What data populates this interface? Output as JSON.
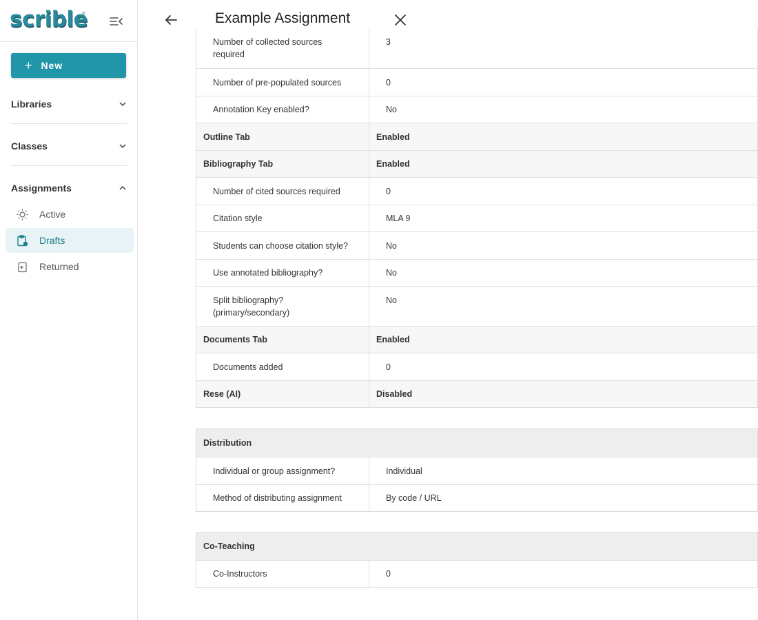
{
  "sidebar": {
    "logo": "scrible",
    "logo_mark": "®",
    "new_label": "New",
    "sections": {
      "libraries": "Libraries",
      "classes": "Classes",
      "assignments": "Assignments"
    },
    "assignment_items": {
      "active": "Active",
      "drafts": "Drafts",
      "returned": "Returned"
    },
    "accent_color": "#2096a8"
  },
  "header": {
    "title": "Example Assignment"
  },
  "settings": {
    "collected_sources_label": "Number of collected sources required",
    "collected_sources_value": "3",
    "prepopulated_label": "Number of pre-populated sources",
    "prepopulated_value": "0",
    "annotation_key_label": "Annotation Key enabled?",
    "annotation_key_value": "No",
    "outline_tab_label": "Outline Tab",
    "outline_tab_value": "Enabled",
    "bibliography_tab_label": "Bibliography Tab",
    "bibliography_tab_value": "Enabled",
    "cited_sources_label": "Number of cited sources required",
    "cited_sources_value": "0",
    "citation_style_label": "Citation style",
    "citation_style_value": "MLA 9",
    "choose_style_label": "Students can choose citation style?",
    "choose_style_value": "No",
    "annotated_bib_label": "Use annotated bibliography?",
    "annotated_bib_value": "No",
    "split_bib_label_1": "Split bibliography?",
    "split_bib_label_2": "(primary/secondary)",
    "split_bib_value": "No",
    "documents_tab_label": "Documents Tab",
    "documents_tab_value": "Enabled",
    "documents_added_label": "Documents added",
    "documents_added_value": "0",
    "rese_label": "Rese (AI)",
    "rese_value": "Disabled"
  },
  "distribution": {
    "heading": "Distribution",
    "type_label": "Individual or group assignment?",
    "type_value": "Individual",
    "method_label": "Method of distributing assignment",
    "method_value": "By code / URL"
  },
  "coteaching": {
    "heading": "Co-Teaching",
    "instructors_label": "Co-Instructors",
    "instructors_value": "0"
  }
}
